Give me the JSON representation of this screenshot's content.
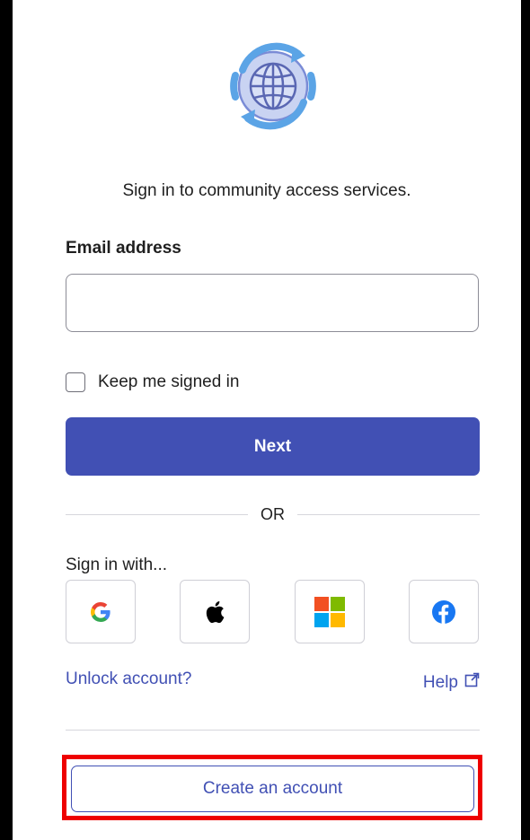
{
  "logo": {
    "icon": "globe-refresh-icon"
  },
  "intro_text": "Sign in to community access services.",
  "email": {
    "label": "Email address",
    "value": "",
    "placeholder": ""
  },
  "keep_signed_in": {
    "label": "Keep me signed in",
    "checked": false
  },
  "next_button": "Next",
  "divider_text": "OR",
  "sign_in_with": {
    "label": "Sign in with...",
    "providers": [
      {
        "name": "Google",
        "icon": "google-icon"
      },
      {
        "name": "Apple",
        "icon": "apple-icon"
      },
      {
        "name": "Microsoft",
        "icon": "microsoft-icon"
      },
      {
        "name": "Facebook",
        "icon": "facebook-icon"
      }
    ]
  },
  "links": {
    "unlock": "Unlock account?",
    "help": "Help",
    "help_icon": "external-link-icon"
  },
  "create_account": "Create an account",
  "colors": {
    "primary": "#4150b4",
    "highlight": "#ee0000",
    "text": "#1f1f1f"
  }
}
